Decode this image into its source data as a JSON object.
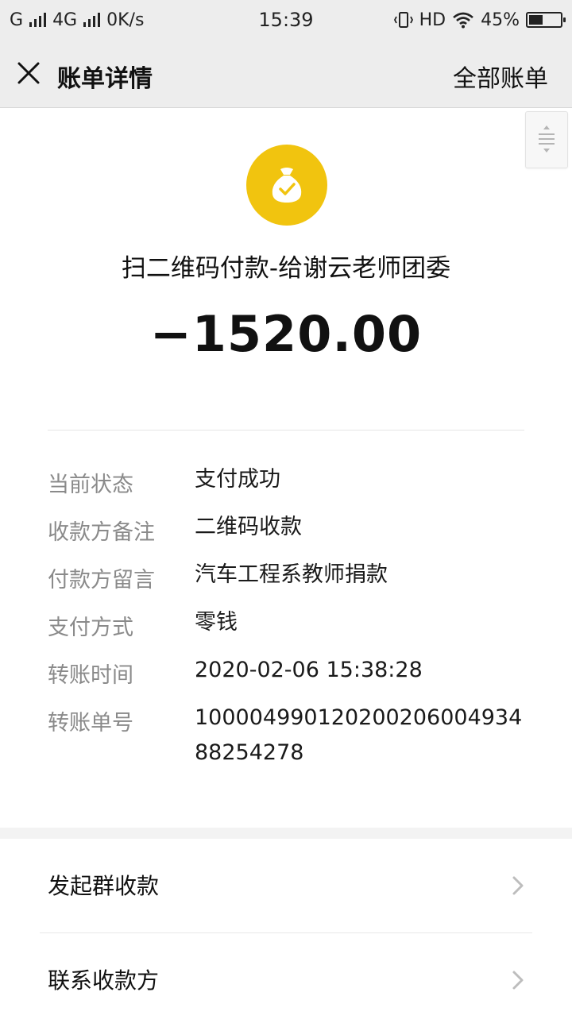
{
  "status_bar": {
    "network_left": "G",
    "network_4g": "4G",
    "speed": "0K/s",
    "time": "15:39",
    "hd": "HD",
    "battery_text": "45%",
    "battery_level": 0.45
  },
  "nav": {
    "title": "账单详情",
    "all_bills": "全部账单"
  },
  "bill": {
    "payee": "扫二维码付款-给谢云老师团委",
    "amount": "−1520.00",
    "accent_color": "#f1c40f"
  },
  "details": [
    {
      "label": "当前状态",
      "value": "支付成功"
    },
    {
      "label": "收款方备注",
      "value": "二维码收款"
    },
    {
      "label": "付款方留言",
      "value": "汽车工程系教师捐款"
    },
    {
      "label": "支付方式",
      "value": "零钱"
    },
    {
      "label": "转账时间",
      "value": "2020-02-06 15:38:28"
    },
    {
      "label": "转账单号",
      "value": "100004990120200206004934 88254278"
    }
  ],
  "actions": [
    {
      "label": "发起群收款"
    },
    {
      "label": "联系收款方"
    }
  ]
}
